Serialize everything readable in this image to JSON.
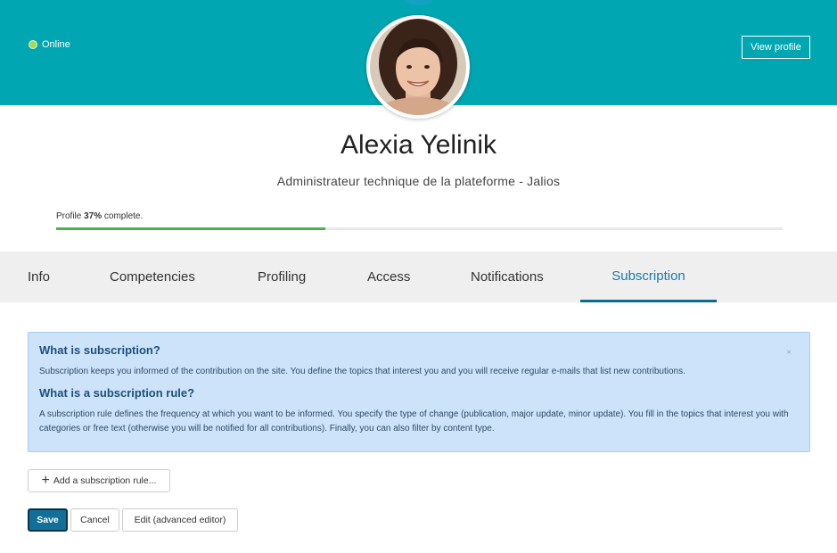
{
  "header": {
    "status": "Online",
    "view_profile": "View profile"
  },
  "profile": {
    "name": "Alexia Yelinik",
    "subtitle": "Administrateur technique de la plateforme - Jalios",
    "progress_prefix": "Profile ",
    "progress_percent_text": "37%",
    "progress_suffix": " complete.",
    "progress_value": 37
  },
  "tabs": [
    {
      "label": "Info"
    },
    {
      "label": "Competencies"
    },
    {
      "label": "Profiling"
    },
    {
      "label": "Access"
    },
    {
      "label": "Notifications"
    },
    {
      "label": "Subscription"
    }
  ],
  "info_box": {
    "title1": "What is subscription?",
    "text1": "Subscription keeps you informed of the contribution on the site. You define the topics that interest you and you will receive regular e-mails that list new contributions.",
    "title2": "What is a subscription rule?",
    "text2": "A subscription rule defines the frequency at which you want to be informed. You specify the type of change (publication, major update, minor update). You fill in the topics that interest you with categories or free text (otherwise you will be notified for all contributions). Finally, you can also filter by content type.",
    "close": "×"
  },
  "actions": {
    "add_rule": "Add a subscription rule...",
    "save": "Save",
    "cancel": "Cancel",
    "edit_advanced": "Edit (advanced editor)"
  },
  "colors": {
    "banner": "#00a7b2",
    "active_tab": "#1a78a8",
    "progress": "#4caf50",
    "save_button": "#116f98"
  }
}
